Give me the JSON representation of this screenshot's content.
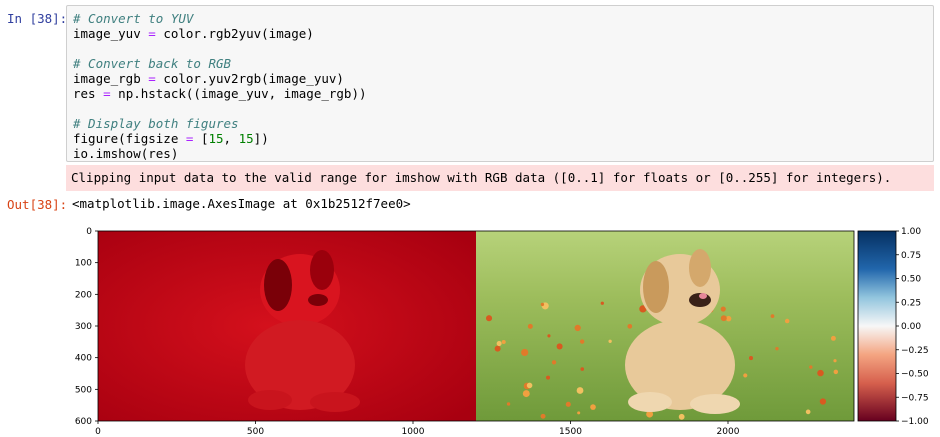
{
  "cell_in": {
    "prompt": "In [38]:",
    "lines": {
      "l1": "# Convert to YUV",
      "l2_a": "image_yuv ",
      "l2_op": "=",
      "l2_b": " color.rgb2yuv(image)",
      "l4": "# Convert back to RGB",
      "l5_a": "image_rgb ",
      "l5_op": "=",
      "l5_b": " color.yuv2rgb(image_yuv)",
      "l6_a": "res ",
      "l6_op": "=",
      "l6_b": " np.hstack((image_yuv, image_rgb))",
      "l8": "# Display both figures",
      "l9_a": "figure(figsize ",
      "l9_op": "=",
      "l9_b": " [",
      "l9_n1": "15",
      "l9_c": ", ",
      "l9_n2": "15",
      "l9_d": "])",
      "l10": "io.imshow(res)"
    }
  },
  "stderr": "Clipping input data to the valid range for imshow with RGB data ([0..1] for floats or [0..255] for integers).",
  "cell_out": {
    "prompt": "Out[38]:",
    "text": "<matplotlib.image.AxesImage at 0x1b2512f7ee0>"
  },
  "plot": {
    "y_ticks": [
      "0",
      "100",
      "200",
      "300",
      "400",
      "500",
      "600"
    ],
    "x_ticks": [
      "0",
      "500",
      "1000",
      "1500",
      "2000"
    ],
    "colorbar_ticks": [
      "1.00",
      "0.75",
      "0.50",
      "0.25",
      "0.00",
      "−0.25",
      "−0.50",
      "−0.75",
      "−1.00"
    ],
    "colors": {
      "yuv_bg": "#c4000f",
      "rgb_grass": "#86a84a",
      "rgb_sky": "#a5c86a",
      "puppy": "#e8c99a",
      "colorbar_top": "#053061",
      "colorbar_mid": "#f7f7f7",
      "colorbar_bottom": "#67001f"
    }
  }
}
